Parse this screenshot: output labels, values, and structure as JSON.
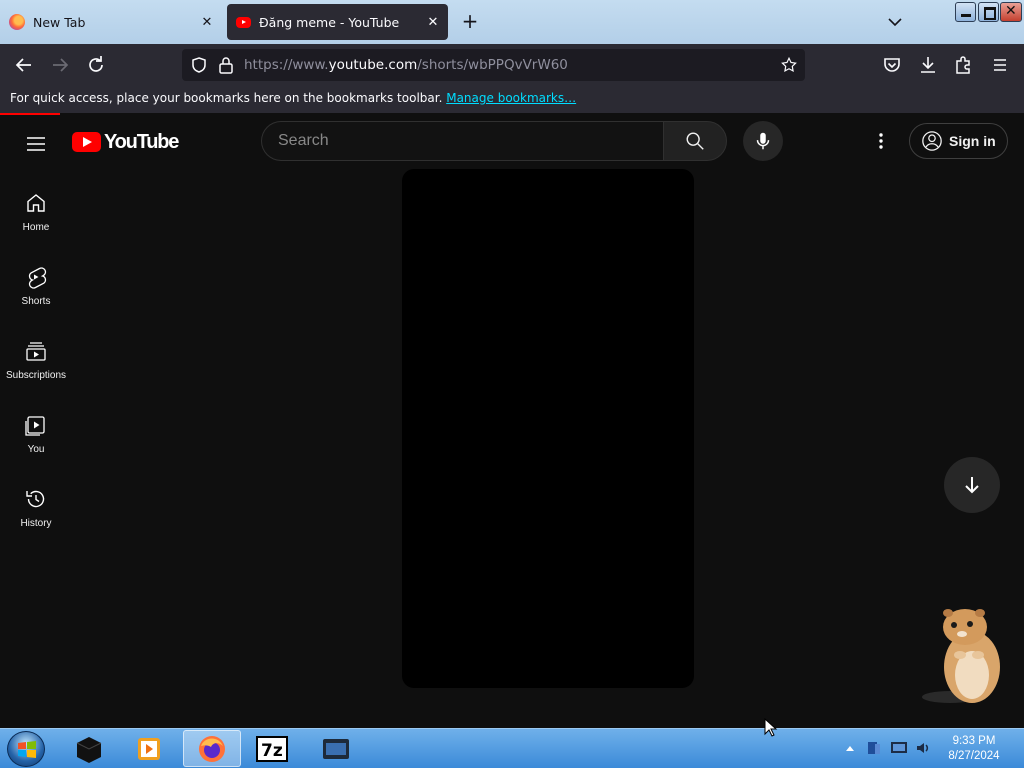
{
  "browser": {
    "tabs": [
      {
        "title": "New Tab",
        "active": false
      },
      {
        "title": "Đăng meme - YouTube",
        "active": true
      }
    ],
    "url": {
      "prefix": "https://www.",
      "domain": "youtube.com",
      "path": "/shorts/wbPPQvVrW60"
    },
    "bookmarks_bar": {
      "message": "For quick access, place your bookmarks here on the bookmarks toolbar. ",
      "link": "Manage bookmarks…"
    }
  },
  "youtube": {
    "logo_text": "YouTube",
    "search_placeholder": "Search",
    "signin_label": "Sign in",
    "sidebar": [
      {
        "label": "Home",
        "icon": "home-icon"
      },
      {
        "label": "Shorts",
        "icon": "shorts-icon"
      },
      {
        "label": "Subscriptions",
        "icon": "subscriptions-icon"
      },
      {
        "label": "You",
        "icon": "you-icon"
      },
      {
        "label": "History",
        "icon": "history-icon"
      }
    ],
    "accent_color": "#ff0000"
  },
  "taskbar": {
    "time": "9:33 PM",
    "date": "8/27/2024",
    "apps": [
      "terminal-icon",
      "media-player-icon",
      "firefox-icon",
      "7zip-icon",
      "remote-desktop-icon"
    ]
  },
  "colors": {
    "page_bg": "#0f0f0f",
    "browser_chrome": "#2b2a33",
    "taskbar": "#3b8ad8"
  }
}
